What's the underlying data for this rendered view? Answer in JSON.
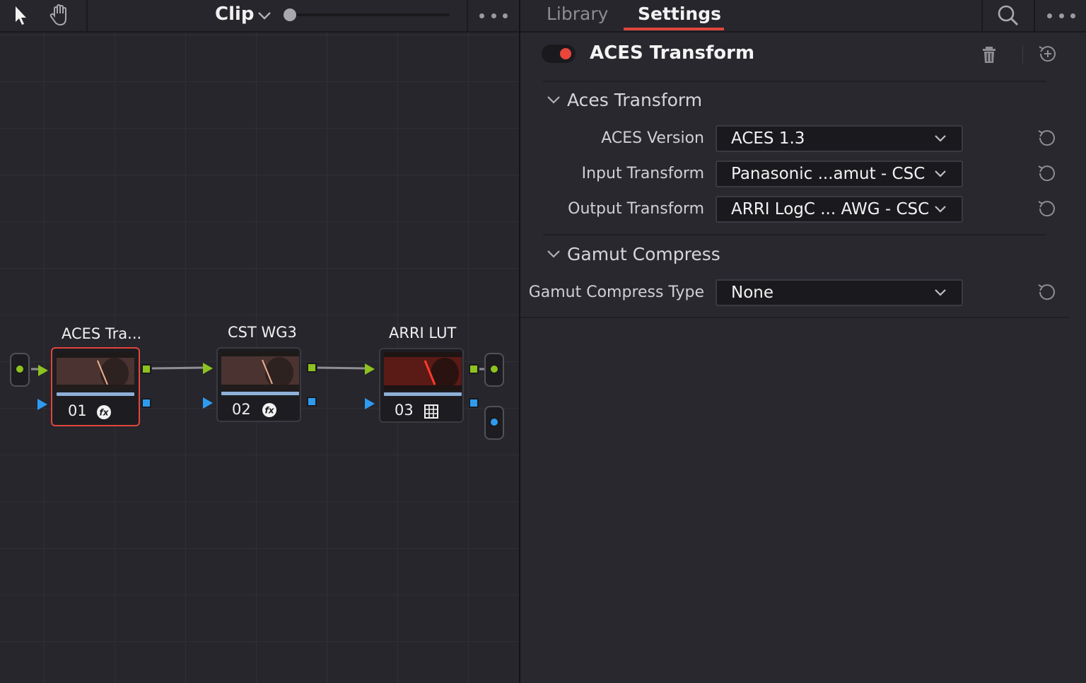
{
  "node_editor": {
    "toolbar": {
      "pointer_tool": "pointer-icon",
      "hand_tool": "hand-icon",
      "mode_label": "Clip",
      "zoom_level": 0.0,
      "more": "more-icon"
    },
    "nodes": [
      {
        "title": "ACES Tra...",
        "number": "01",
        "icon": "fx-icon",
        "selected": true
      },
      {
        "title": "CST WG3",
        "number": "02",
        "icon": "fx-icon",
        "selected": false
      },
      {
        "title": "ARRI LUT",
        "number": "03",
        "icon": "lut-grid-icon",
        "selected": false
      }
    ],
    "colors": {
      "rgb_link": "#8ec21f",
      "alpha_link": "#2e9bf0",
      "selection": "#e0463c"
    }
  },
  "inspector": {
    "tabs": [
      {
        "label": "Library",
        "active": false
      },
      {
        "label": "Settings",
        "active": true
      }
    ],
    "search": "search-icon",
    "more": "more-icon",
    "effect": {
      "enabled": true,
      "title": "ACES Transform",
      "delete": "trash-icon",
      "add": "add-keyframe-icon"
    },
    "sections": [
      {
        "title": "Aces Transform",
        "params": [
          {
            "label": "ACES Version",
            "value": "ACES 1.3"
          },
          {
            "label": "Input Transform",
            "value": "Panasonic ...amut - CSC"
          },
          {
            "label": "Output Transform",
            "value": "ARRI LogC ... AWG - CSC"
          }
        ]
      },
      {
        "title": "Gamut Compress",
        "params": [
          {
            "label": "Gamut Compress Type",
            "value": "None"
          }
        ]
      }
    ]
  }
}
